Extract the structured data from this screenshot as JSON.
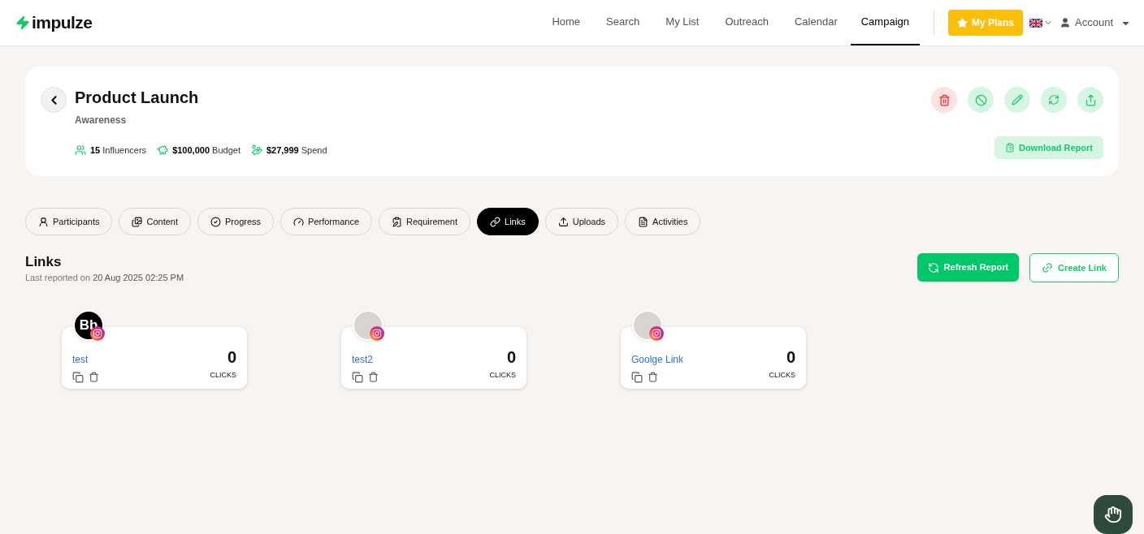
{
  "brand": {
    "name": "impulze"
  },
  "nav": [
    {
      "label": "Home",
      "selected": false
    },
    {
      "label": "Search",
      "selected": false
    },
    {
      "label": "My List",
      "selected": false
    },
    {
      "label": "Outreach",
      "selected": false
    },
    {
      "label": "Calendar",
      "selected": false
    },
    {
      "label": "Campaign",
      "selected": true
    }
  ],
  "plans_button": "My Plans",
  "account": "Account",
  "campaign": {
    "title": "Product Launch",
    "objective": "Awareness",
    "stats": [
      {
        "value": "15",
        "label": "Influencers"
      },
      {
        "value": "$100,000",
        "label": "Budget"
      },
      {
        "value": "$27,999",
        "label": "Spend"
      }
    ],
    "download_button": "Download Report"
  },
  "tabs": [
    {
      "label": "Participants",
      "selected": false
    },
    {
      "label": "Content",
      "selected": false
    },
    {
      "label": "Progress",
      "selected": false
    },
    {
      "label": "Performance",
      "selected": false
    },
    {
      "label": "Requirement",
      "selected": false
    },
    {
      "label": "Links",
      "selected": true
    },
    {
      "label": "Uploads",
      "selected": false
    },
    {
      "label": "Activities",
      "selected": false
    }
  ],
  "section": {
    "title": "Links",
    "reported_label": "Last reported on",
    "reported_at": "20 Aug 2025 02:25 PM",
    "refresh_button": "Refresh Report",
    "create_button": "Create Link"
  },
  "links": [
    {
      "name": "test",
      "clicks": "0",
      "clicks_label": "CLICKS",
      "avatar": {
        "kind": "initials",
        "text": "Bb"
      }
    },
    {
      "name": "test2",
      "clicks": "0",
      "clicks_label": "CLICKS",
      "avatar": {
        "kind": "photo"
      }
    },
    {
      "name": "Goolge Link",
      "clicks": "0",
      "clicks_label": "CLICKS",
      "avatar": {
        "kind": "photo"
      }
    }
  ]
}
